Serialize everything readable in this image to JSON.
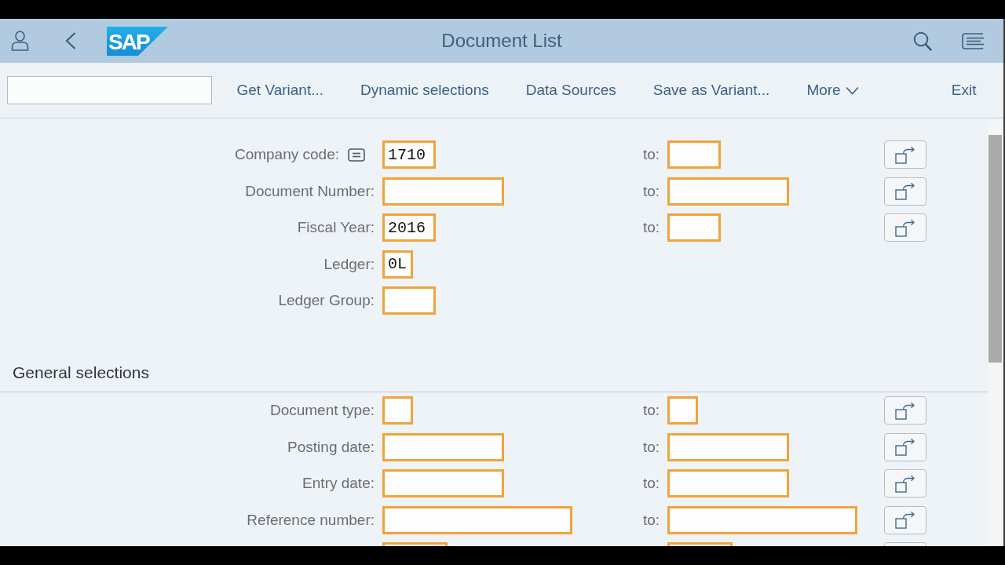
{
  "header": {
    "logo": "SAP",
    "title": "Document List"
  },
  "toolbar": {
    "buttons": [
      {
        "label": "Get Variant...",
        "kind": "action"
      },
      {
        "label": "Dynamic selections",
        "kind": "action"
      },
      {
        "label": "Data Sources",
        "kind": "action"
      },
      {
        "label": "Save as Variant...",
        "kind": "action"
      },
      {
        "label": "More",
        "kind": "menu"
      },
      {
        "label": "Exit",
        "kind": "exit"
      }
    ]
  },
  "sections": [
    {
      "rows": [
        {
          "label": "Company code:",
          "value": "1710",
          "list_icon": true,
          "range": true,
          "to_label": "to:"
        },
        {
          "label": "Document Number:",
          "list_icon": false,
          "range": true,
          "to_label": "to:"
        },
        {
          "label": "Fiscal Year:",
          "value": "2016",
          "list_icon": false,
          "range": true,
          "to_label": "to:"
        },
        {
          "label": "Ledger:",
          "value": "0L",
          "list_icon": false,
          "range": false
        },
        {
          "label": "Ledger Group:",
          "list_icon": false,
          "range": false
        }
      ]
    },
    {
      "title": "General selections",
      "rows": [
        {
          "label": "Document type:",
          "list_icon": false,
          "range": true,
          "to_label": "to:"
        },
        {
          "label": "Posting date:",
          "list_icon": false,
          "range": true,
          "to_label": "to:"
        },
        {
          "label": "Entry date:",
          "list_icon": false,
          "range": true,
          "to_label": "to:"
        },
        {
          "label": "Reference number:",
          "list_icon": false,
          "range": true,
          "to_label": "to:"
        },
        {
          "list_icon": false,
          "range": true
        }
      ]
    }
  ]
}
